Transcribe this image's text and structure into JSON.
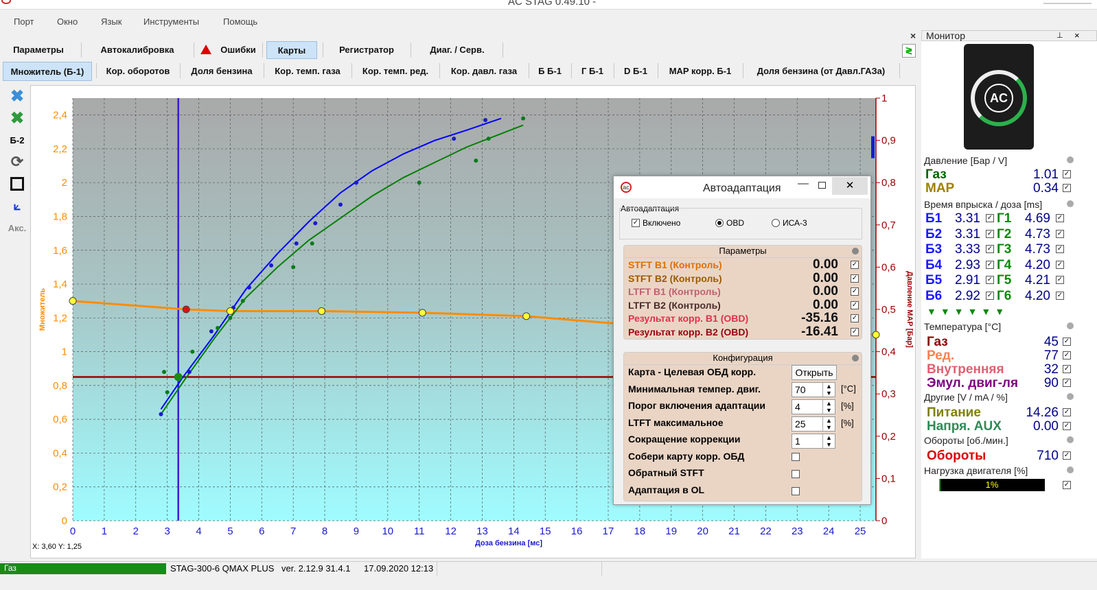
{
  "window": {
    "title": "AC STAG 0.49.10 -"
  },
  "menu": [
    "Порт",
    "Окно",
    "Язык",
    "Инструменты",
    "Помощь"
  ],
  "tabs1": [
    {
      "label": "Параметры"
    },
    {
      "label": "Автокалибровка"
    },
    {
      "label": "Ошибки"
    },
    {
      "label": "Карты"
    },
    {
      "label": "Регистратор"
    },
    {
      "label": "Диаг. / Серв."
    }
  ],
  "tabs2": [
    {
      "label": "Множитель (Б-1)"
    },
    {
      "label": "Кор. оборотов"
    },
    {
      "label": "Доля бензина"
    },
    {
      "label": "Кор. темп. газа"
    },
    {
      "label": "Кор. темп. ред."
    },
    {
      "label": "Кор. давл. газа"
    },
    {
      "label": "Б Б-1"
    },
    {
      "label": "Г Б-1"
    },
    {
      "label": "D Б-1"
    },
    {
      "label": "MAP корр. Б-1"
    },
    {
      "label": "Доля бензина (от Давл.ГАЗа)"
    }
  ],
  "toolbar": {
    "bank_label": "Б-2",
    "acc_label": "Акс."
  },
  "chart": {
    "ylabel": "Множитель",
    "xlabel": "Доза бензина [мс]",
    "y2label": "Давление МАР [Бар]",
    "cursor": "X: 3,60  Y: 1,25"
  },
  "chart_data": {
    "type": "line",
    "xlim": [
      0,
      25.5
    ],
    "ylim": [
      0,
      2.5
    ],
    "y2lim": [
      0,
      1
    ],
    "x_ticks": [
      "0",
      "1",
      "2",
      "3",
      "4",
      "5",
      "6",
      "7",
      "8",
      "9",
      "10",
      "11",
      "12",
      "13",
      "14",
      "15",
      "16",
      "17",
      "18",
      "19",
      "20",
      "21",
      "22",
      "23",
      "24",
      "25"
    ],
    "y_ticks": [
      "0",
      "0,2",
      "0,4",
      "0,6",
      "0,8",
      "1",
      "1,2",
      "1,4",
      "1,6",
      "1,8",
      "2",
      "2,2",
      "2,4"
    ],
    "y2_ticks": [
      "0",
      "0,1",
      "0,2",
      "0,3",
      "0,4",
      "0,5",
      "0,6",
      "0,7",
      "0,8",
      "0,9",
      "1"
    ],
    "grid": true,
    "series": [
      {
        "color": "#ff8c00",
        "points": [
          [
            0,
            1.3
          ],
          [
            3.6,
            1.25
          ],
          [
            5,
            1.24
          ],
          [
            7.9,
            1.24
          ],
          [
            11.1,
            1.23
          ],
          [
            14.4,
            1.21
          ],
          [
            17,
            1.17
          ],
          [
            25.5,
            1.1
          ]
        ]
      },
      {
        "color": "#0000ff",
        "points": [
          [
            2.8,
            0.66
          ],
          [
            3.5,
            0.85
          ],
          [
            4.5,
            1.1
          ],
          [
            5.5,
            1.37
          ],
          [
            6.5,
            1.58
          ],
          [
            7.5,
            1.77
          ],
          [
            8.5,
            1.94
          ],
          [
            9.5,
            2.07
          ],
          [
            10.5,
            2.17
          ],
          [
            11.5,
            2.25
          ],
          [
            12.5,
            2.31
          ],
          [
            13.6,
            2.38
          ]
        ]
      },
      {
        "color": "#008000",
        "points": [
          [
            2.8,
            0.63
          ],
          [
            3.5,
            0.82
          ],
          [
            4.5,
            1.08
          ],
          [
            5.5,
            1.32
          ],
          [
            6.5,
            1.5
          ],
          [
            7.5,
            1.66
          ],
          [
            8.5,
            1.79
          ],
          [
            9.5,
            1.92
          ],
          [
            10.5,
            2.03
          ],
          [
            11.5,
            2.12
          ],
          [
            12.5,
            2.21
          ],
          [
            14.3,
            2.34
          ]
        ]
      }
    ],
    "blue_points": [
      [
        2.8,
        0.63
      ],
      [
        3.7,
        0.88
      ],
      [
        4.4,
        1.12
      ],
      [
        5.1,
        1.26
      ],
      [
        5.6,
        1.38
      ],
      [
        6.3,
        1.51
      ],
      [
        7.1,
        1.64
      ],
      [
        7.7,
        1.76
      ],
      [
        8.5,
        1.87
      ],
      [
        9,
        2.0
      ],
      [
        12.1,
        2.26
      ],
      [
        13.1,
        2.37
      ]
    ],
    "green_points": [
      [
        2.9,
        0.88
      ],
      [
        3.0,
        0.76
      ],
      [
        3.8,
        1.0
      ],
      [
        4.6,
        1.14
      ],
      [
        5.0,
        1.2
      ],
      [
        5.4,
        1.3
      ],
      [
        7.0,
        1.5
      ],
      [
        7.6,
        1.64
      ],
      [
        11.0,
        2.0
      ],
      [
        12.8,
        2.13
      ],
      [
        13.2,
        2.26
      ],
      [
        14.3,
        2.38
      ]
    ],
    "yellow_markers": [
      [
        0,
        1.3
      ],
      [
        5,
        1.24
      ],
      [
        7.9,
        1.24
      ],
      [
        11.1,
        1.23
      ],
      [
        14.4,
        1.21
      ],
      [
        25.5,
        1.1
      ]
    ],
    "red_marker": [
      3.6,
      1.25
    ],
    "vline_x": 3.35,
    "hline_y": 0.85,
    "hline_color": "#9b0000"
  },
  "monitor": {
    "title": "Монитор",
    "pressure_title": "Давление [Бар / V]",
    "pressure": [
      {
        "label": "Газ",
        "value": "1.01",
        "color": "#006400"
      },
      {
        "label": "MAP",
        "value": "0.34",
        "color": "#a08000"
      }
    ],
    "injection_title": "Время впрыска / доза [ms]",
    "injection": [
      {
        "b": "Б1",
        "bv": "3.31",
        "g": "Г1",
        "gv": "4.69"
      },
      {
        "b": "Б2",
        "bv": "3.31",
        "g": "Г2",
        "gv": "4.73"
      },
      {
        "b": "Б3",
        "bv": "3.33",
        "g": "Г3",
        "gv": "4.73"
      },
      {
        "b": "Б4",
        "bv": "2.93",
        "g": "Г4",
        "gv": "4.20"
      },
      {
        "b": "Б5",
        "bv": "2.91",
        "g": "Г5",
        "gv": "4.21"
      },
      {
        "b": "Б6",
        "bv": "2.92",
        "g": "Г6",
        "gv": "4.20"
      }
    ],
    "temp_title": "Температура [°C]",
    "temp": [
      {
        "label": "Газ",
        "value": "45",
        "color": "#8b0000"
      },
      {
        "label": "Ред.",
        "value": "77",
        "color": "#ff7f50"
      },
      {
        "label": "Внутренняя",
        "value": "32",
        "color": "#e06070"
      },
      {
        "label": "Эмул. двиг-ля",
        "value": "90",
        "color": "#800080"
      }
    ],
    "other_title": "Другие [V / mA / %]",
    "other": [
      {
        "label": "Питание",
        "value": "14.26",
        "color": "#808000"
      },
      {
        "label": "Напря. AUX",
        "value": "0.00",
        "color": "#2e8b57"
      }
    ],
    "rpm_title": "Обороты [об./мин.]",
    "rpm": {
      "label": "Обороты",
      "value": "710",
      "color": "#dd0000"
    },
    "load_title": "Нагрузка двигателя [%]",
    "load": {
      "text": "1%",
      "fraction": 0.01
    }
  },
  "dialog": {
    "title": "Автоадаптация",
    "group_label": "Автоадаптация",
    "enabled_label": "Включено",
    "radio_obd": "OBD",
    "radio_isa": "ИСА-3",
    "params_title": "Параметры",
    "params": [
      {
        "label": "STFT B1 (Контроль)",
        "value": "0.00",
        "color": "#e07000"
      },
      {
        "label": "STFT B2 (Контроль)",
        "value": "0.00",
        "color": "#9b5a00"
      },
      {
        "label": "LTFT B1 (Контроль)",
        "value": "0.00",
        "color": "#c06070"
      },
      {
        "label": "LTFT B2 (Контроль)",
        "value": "0.00",
        "color": "#4a2a2a"
      },
      {
        "label": "Результат корр. B1 (OBD)",
        "value": "-35.16",
        "color": "#e0304a"
      },
      {
        "label": "Результат корр. B2 (OBD)",
        "value": "-16.41",
        "color": "#9b0010"
      }
    ],
    "config_title": "Конфигурация",
    "map_label": "Карта - Целевая ОБД корр.",
    "open_button": "Открыть",
    "min_temp_label": "Минимальная темпер. двиг.",
    "min_temp": "70",
    "min_temp_unit": "[°C]",
    "threshold_label": "Порог включения адаптации",
    "threshold": "4",
    "threshold_unit": "[%]",
    "ltft_max_label": "LTFT максимальное",
    "ltft_max": "25",
    "ltft_max_unit": "[%]",
    "reduce_label": "Сокращение коррекции",
    "reduce": "1",
    "collect_label": "Собери карту корр. ОБД",
    "reverse_label": "Обратный STFT",
    "ol_label": "Адаптация в OL"
  },
  "status": {
    "fuel": "Газ",
    "device": "STAG-300-6 QMAX PLUS",
    "version": "ver. 2.12.9  31.4.1",
    "date": "17.09.2020 12:13"
  }
}
